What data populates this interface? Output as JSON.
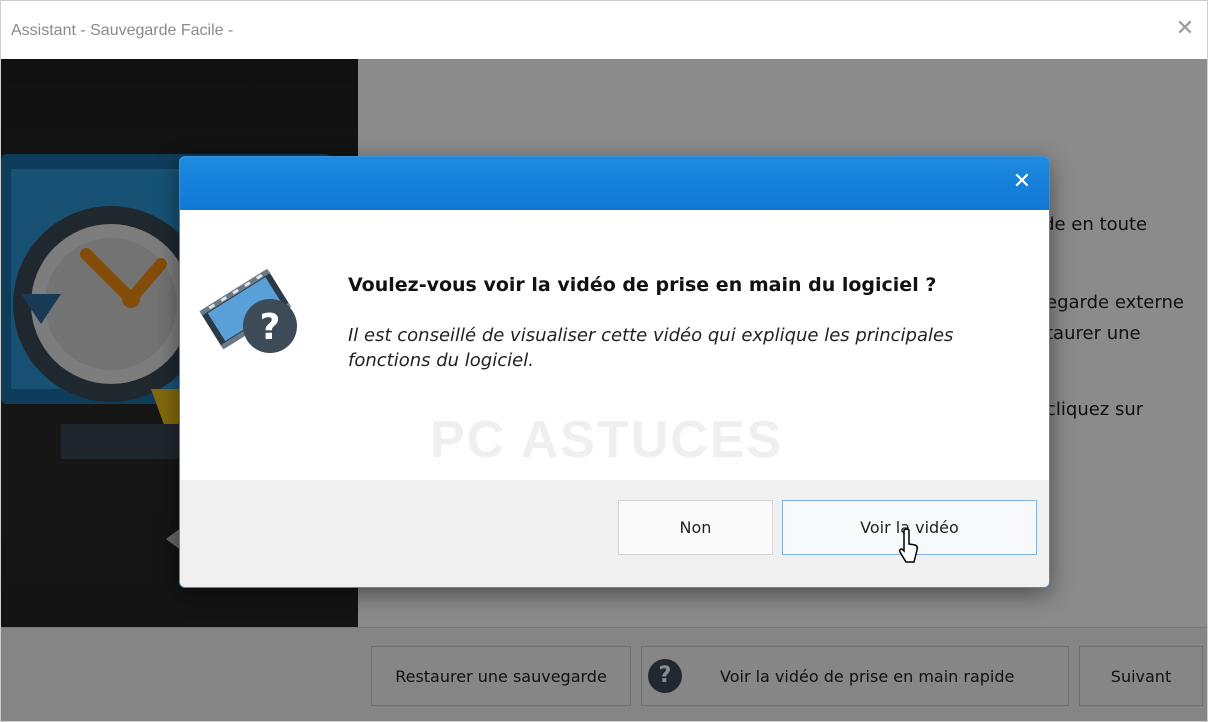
{
  "window": {
    "title": "Assistant - Sauvegarde Facile -",
    "close_glyph": "✕"
  },
  "background": {
    "partial_texts": [
      "rde en toute",
      "egarde externe",
      "taurer une",
      "cliquez sur"
    ]
  },
  "bottom_bar": {
    "restore_label": "Restaurer une sauvegarde",
    "video_label": "Voir la vidéo de prise en main rapide",
    "next_label": "Suivant",
    "help_glyph": "?"
  },
  "dialog": {
    "close_glyph": "✕",
    "heading": "Voulez-vous voir la vidéo de prise en main du logiciel ?",
    "description": "Il est conseillé de visualiser cette vidéo qui explique les principales fonctions du logiciel.",
    "watermark": "PC ASTUCES",
    "icon": "video-help-icon",
    "buttons": {
      "no_label": "Non",
      "yes_label": "Voir la vidéo"
    }
  },
  "colors": {
    "dialog_header": "#0f78d4",
    "help_circle": "#3d4a57"
  }
}
